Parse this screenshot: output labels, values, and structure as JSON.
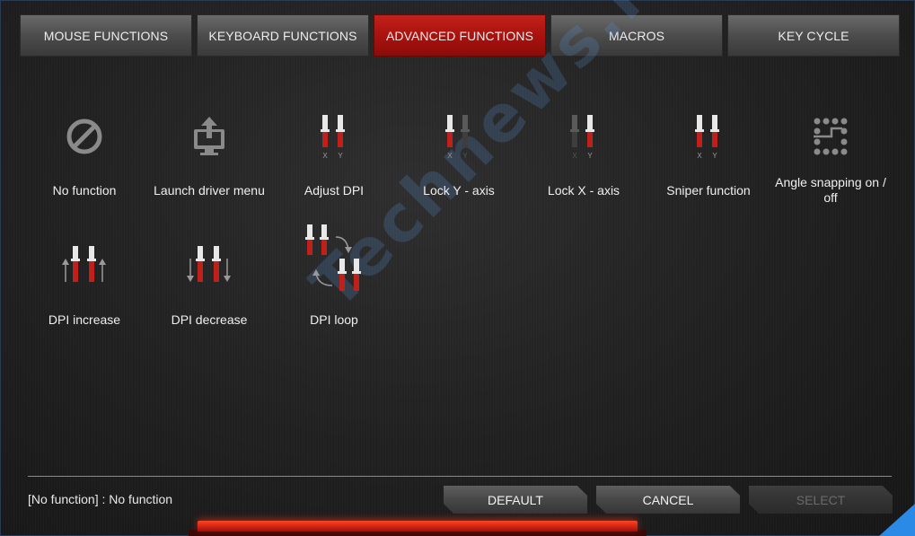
{
  "tabs": [
    {
      "label": "MOUSE FUNCTIONS",
      "active": false
    },
    {
      "label": "KEYBOARD FUNCTIONS",
      "active": false
    },
    {
      "label": "ADVANCED FUNCTIONS",
      "active": true
    },
    {
      "label": "MACROS",
      "active": false
    },
    {
      "label": "KEY CYCLE",
      "active": false
    }
  ],
  "functions": [
    {
      "label": "No function",
      "icon": "no-function-icon"
    },
    {
      "label": "Launch driver menu",
      "icon": "launch-driver-icon"
    },
    {
      "label": "Adjust DPI",
      "icon": "adjust-dpi-icon"
    },
    {
      "label": "Lock Y - axis",
      "icon": "lock-y-axis-icon"
    },
    {
      "label": "Lock X - axis",
      "icon": "lock-x-axis-icon"
    },
    {
      "label": "Sniper function",
      "icon": "sniper-icon"
    },
    {
      "label": "Angle snapping on / off",
      "icon": "angle-snapping-icon"
    },
    {
      "label": "DPI increase",
      "icon": "dpi-increase-icon"
    },
    {
      "label": "DPI decrease",
      "icon": "dpi-decrease-icon"
    },
    {
      "label": "DPI loop",
      "icon": "dpi-loop-icon"
    }
  ],
  "axis_labels": {
    "x": "X",
    "y": "Y"
  },
  "status": "[No function] : No function",
  "buttons": {
    "default": "DEFAULT",
    "cancel": "CANCEL",
    "select": "SELECT"
  },
  "watermark": {
    "brand": "Technews.lt"
  },
  "colors": {
    "accent": "#b5150f",
    "slider_red": "#c0201a",
    "icon_gray": "#8a8a8a",
    "corner": "#2b8ae6"
  }
}
